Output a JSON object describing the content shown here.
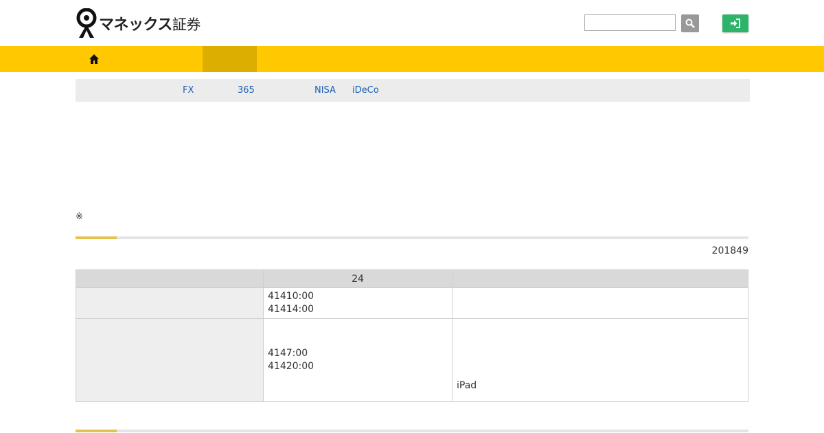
{
  "brand": {
    "name": "マネックス",
    "suffix": "証券"
  },
  "header": {
    "search_placeholder": ""
  },
  "nav": {
    "home_icon": "home-icon"
  },
  "subnav": {
    "items": [
      {
        "label": "FX"
      },
      {
        "label": "365"
      },
      {
        "label": "NISA"
      },
      {
        "label": "iDeCo"
      }
    ]
  },
  "notice": {
    "mark": "※"
  },
  "section": {
    "date": "201849"
  },
  "table": {
    "header": {
      "col2": "24"
    },
    "rows": [
      {
        "lines": [
          "41410:00",
          "41414:00"
        ],
        "right": ""
      },
      {
        "lines": [
          "4147:00",
          "41420:00"
        ],
        "right": "iPad"
      }
    ]
  },
  "colors": {
    "nav": "#ffc800",
    "nav_active": "#dcae00",
    "login": "#2db46a",
    "link": "#1a5fb4",
    "accent": "#e3c24e"
  }
}
